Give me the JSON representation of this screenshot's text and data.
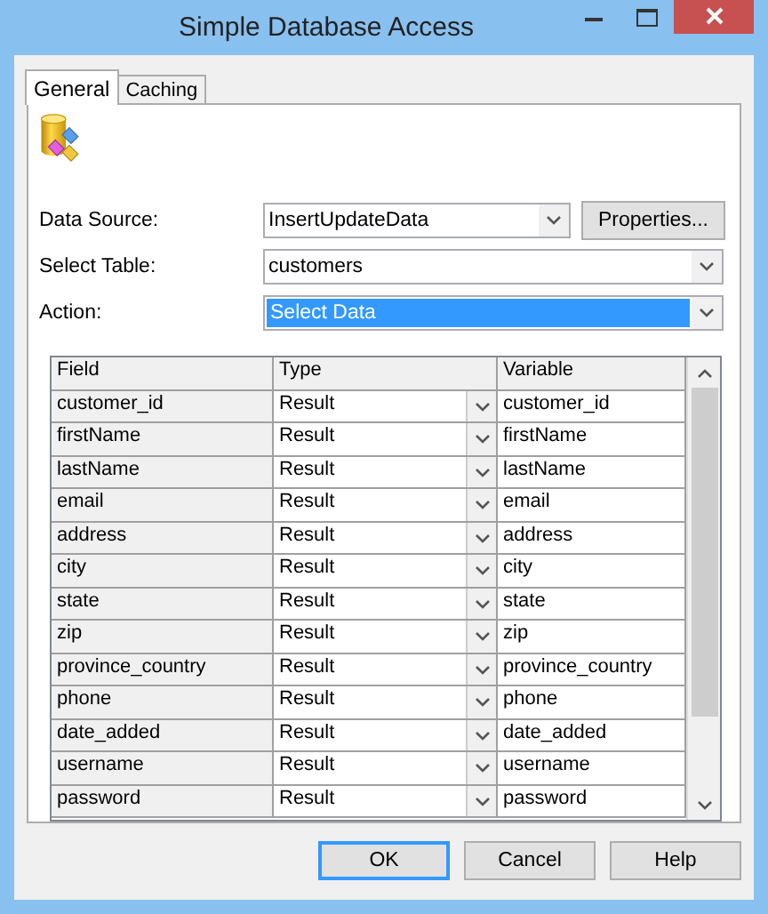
{
  "window": {
    "title": "Simple Database Access"
  },
  "tabs": [
    {
      "label": "General",
      "selected": true
    },
    {
      "label": "Caching",
      "selected": false
    }
  ],
  "form": [
    {
      "label": "Data Source:",
      "value": "InsertUpdateData",
      "highlighted": false,
      "button": "Properties..."
    },
    {
      "label": "Select Table:",
      "value": "customers",
      "highlighted": false
    },
    {
      "label": "Action:",
      "value": "Select Data",
      "highlighted": true
    }
  ],
  "table": {
    "columns": [
      "Field",
      "Type",
      "Variable"
    ],
    "rows": [
      {
        "field": "customer_id",
        "type": "Result",
        "variable": "customer_id"
      },
      {
        "field": "firstName",
        "type": "Result",
        "variable": "firstName"
      },
      {
        "field": "lastName",
        "type": "Result",
        "variable": "lastName"
      },
      {
        "field": "email",
        "type": "Result",
        "variable": "email"
      },
      {
        "field": "address",
        "type": "Result",
        "variable": "address"
      },
      {
        "field": "city",
        "type": "Result",
        "variable": "city"
      },
      {
        "field": "state",
        "type": "Result",
        "variable": "state"
      },
      {
        "field": "zip",
        "type": "Result",
        "variable": "zip"
      },
      {
        "field": "province_country",
        "type": "Result",
        "variable": "province_country"
      },
      {
        "field": "phone",
        "type": "Result",
        "variable": "phone"
      },
      {
        "field": "date_added",
        "type": "Result",
        "variable": "date_added"
      },
      {
        "field": "username",
        "type": "Result",
        "variable": "username"
      },
      {
        "field": "password",
        "type": "Result",
        "variable": "password"
      }
    ]
  },
  "buttons": [
    {
      "label": "OK",
      "default": true
    },
    {
      "label": "Cancel",
      "default": false
    },
    {
      "label": "Help",
      "default": false
    }
  ]
}
